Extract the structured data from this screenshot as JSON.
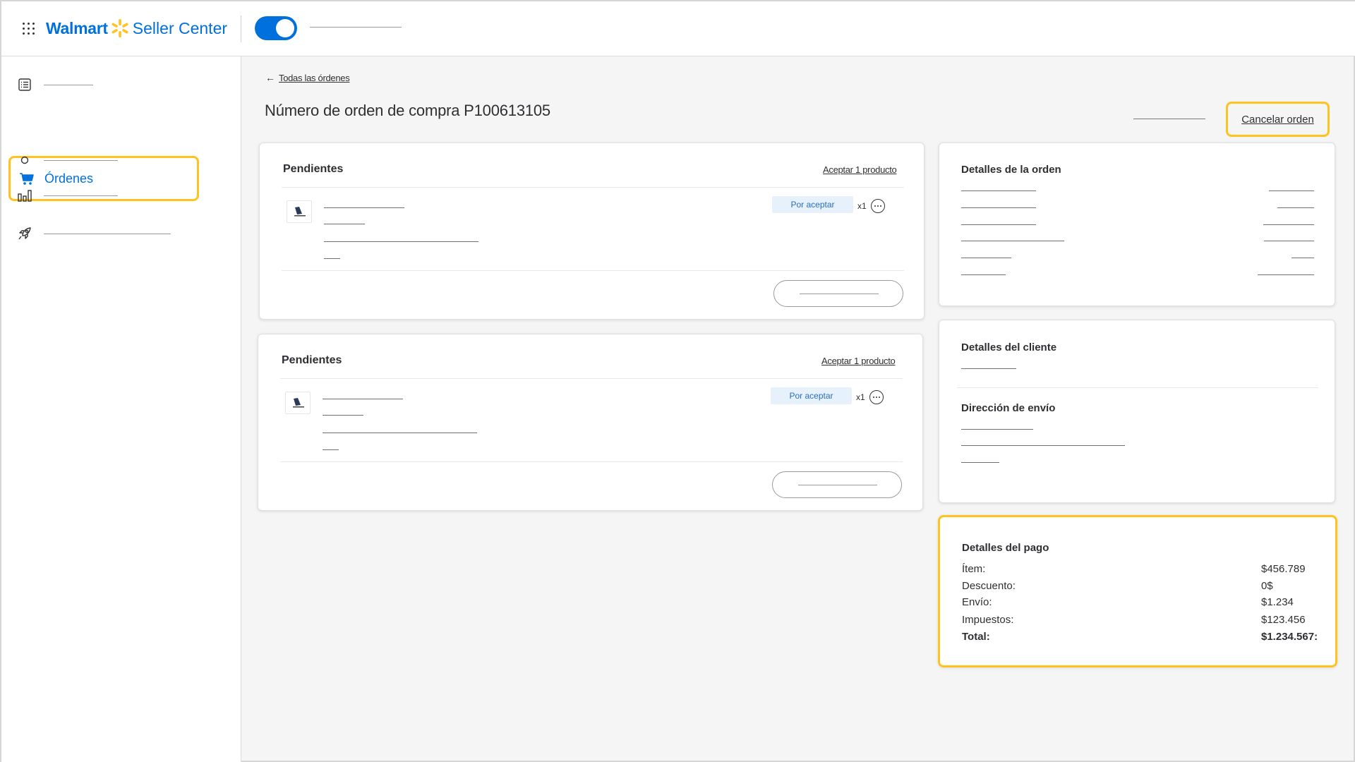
{
  "header": {
    "brand": "Walmart",
    "product": "Seller Center",
    "brand_color": "#0071dc",
    "spark_color": "#ffc220"
  },
  "sidebar": {
    "active_item": {
      "label": "Órdenes",
      "icon": "cart-icon"
    },
    "items": [
      {
        "icon": "list-icon"
      },
      {
        "icon": "cart-icon",
        "label": "Órdenes"
      },
      {
        "icon": "circle-icon"
      },
      {
        "icon": "bar-chart-icon"
      },
      {
        "icon": "rocket-icon"
      }
    ]
  },
  "main": {
    "back_link": "Todas las órdenes",
    "title": "Número de orden de compra P100613105",
    "cancel_label": "Cancelar orden",
    "orders": [
      {
        "title": "Pendientes",
        "accept_label": "Aceptar 1 producto",
        "status": "Por aceptar",
        "qty": "x1"
      },
      {
        "title": "Pendientes",
        "accept_label": "Aceptar 1 producto",
        "status": "Por aceptar",
        "qty": "x1"
      }
    ]
  },
  "order_details": {
    "title": "Detalles de la orden"
  },
  "customer": {
    "title": "Detalles del cliente",
    "shipping_title": "Dirección de envío"
  },
  "payment": {
    "title": "Detalles del pago",
    "rows": [
      {
        "label": "Ítem:",
        "value": "$456.789"
      },
      {
        "label": "Descuento:",
        "value": "0$"
      },
      {
        "label": "Envío:",
        "value": "$1.234"
      },
      {
        "label": "Impuestos:",
        "value": "$123.456"
      },
      {
        "label": "Total:",
        "value": "$1.234.567:"
      }
    ]
  },
  "colors": {
    "highlight": "#ffc220",
    "badge_bg": "#e6f1fc",
    "badge_text": "#2a6ebf"
  }
}
